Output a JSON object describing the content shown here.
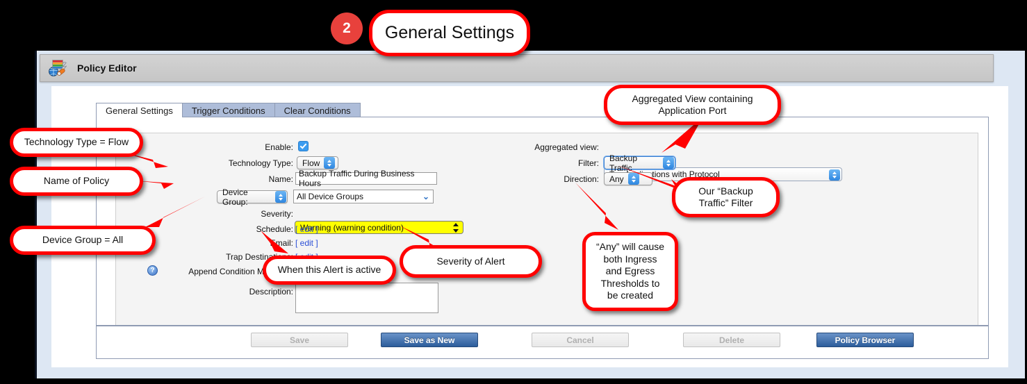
{
  "annotation": {
    "step_number": "2",
    "step_title": "General Settings",
    "callouts": [
      {
        "id": "technology-type",
        "text": "Technology Type = Flow"
      },
      {
        "id": "name-of-policy",
        "text": "Name of Policy"
      },
      {
        "id": "device-group",
        "text": "Device Group  = All"
      },
      {
        "id": "when-active",
        "text": "When this Alert is active"
      },
      {
        "id": "severity-of-alert",
        "text": "Severity of Alert"
      },
      {
        "id": "aggregated-view",
        "line1": "Aggregated View containing",
        "line2": "Application Port"
      },
      {
        "id": "backup-filter",
        "line1": "Our “Backup",
        "line2": "Traffic” Filter"
      },
      {
        "id": "any-direction",
        "line1": "“Any” will cause",
        "line2": "both Ingress",
        "line3": "and Egress",
        "line4": "Thresholds to",
        "line5": "be created"
      }
    ]
  },
  "window": {
    "title": "Policy Editor",
    "icon": "policy-editor-icon"
  },
  "tabs": [
    {
      "label": "General Settings",
      "active": true
    },
    {
      "label": "Trigger Conditions",
      "active": false
    },
    {
      "label": "Clear Conditions",
      "active": false
    }
  ],
  "form": {
    "left": {
      "enable_label": "Enable:",
      "enable_checked": true,
      "technology_type_label": "Technology Type:",
      "technology_type_value": "Flow",
      "name_label": "Name:",
      "name_value": "Backup Traffic During Business Hours",
      "device_group_label": "Device Group:",
      "device_group_value": "All Device Groups",
      "severity_label": "Severity:",
      "severity_value": "Warning (warning condition)",
      "severity_color": "#ffff00",
      "schedule_label": "Schedule:",
      "schedule_link": "[ edit ]",
      "email_label": "Email:",
      "email_link": "[ edit ]",
      "trap_label": "Trap Destinations:",
      "trap_link": "[ edit ]",
      "append_label": "Append Condition Message:",
      "append_checked": true,
      "help_glyph": "?",
      "description_label": "Description:",
      "description_value": ""
    },
    "right": {
      "aggregated_view_label": "Aggregated view:",
      "aggregated_view_value": "Top Applications with Protocol",
      "filter_label": "Filter:",
      "filter_value": "Backup Traffic",
      "direction_label": "Direction:",
      "direction_value": "Any"
    }
  },
  "buttons": [
    {
      "id": "save",
      "label": "Save",
      "state": "disabled"
    },
    {
      "id": "save-as-new",
      "label": "Save as New",
      "state": "primary"
    },
    {
      "id": "cancel",
      "label": "Cancel",
      "state": "disabled"
    },
    {
      "id": "delete",
      "label": "Delete",
      "state": "disabled"
    },
    {
      "id": "policy-browser",
      "label": "Policy Browser",
      "state": "primary"
    }
  ],
  "colors": {
    "accent_red": "#ff0000",
    "primary_blue": "#2c5d9b",
    "warning_yellow": "#ffff00",
    "checkbox_blue": "#3c9cf0"
  }
}
